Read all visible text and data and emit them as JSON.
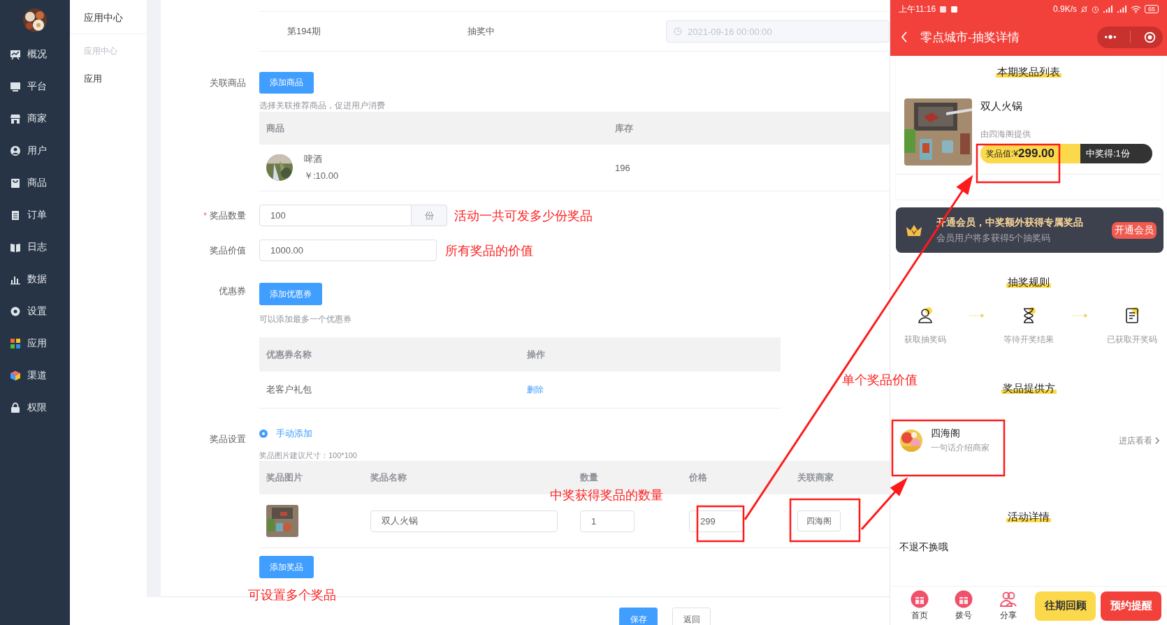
{
  "sidebar": {
    "items": [
      {
        "label": "概况"
      },
      {
        "label": "平台"
      },
      {
        "label": "商家"
      },
      {
        "label": "用户"
      },
      {
        "label": "商品"
      },
      {
        "label": "订单"
      },
      {
        "label": "日志"
      },
      {
        "label": "数据"
      },
      {
        "label": "设置"
      },
      {
        "label": "应用"
      },
      {
        "label": "渠道"
      },
      {
        "label": "权限"
      }
    ]
  },
  "submenu": {
    "title": "应用中心",
    "group": "应用中心",
    "items": [
      "应用"
    ]
  },
  "period_row": {
    "name": "第194期",
    "status": "抽奖中",
    "date": "2021-09-16 00:00:00"
  },
  "goods": {
    "label": "关联商品",
    "button": "添加商品",
    "hint": "选择关联推荐商品，促进用户消费",
    "columns": [
      "商品",
      "库存"
    ],
    "rows": [
      {
        "name": "啤酒",
        "price": "￥:10.00",
        "stock": "196"
      }
    ]
  },
  "prize_count": {
    "label": "奖品数量",
    "required_mark": "*",
    "value": "100",
    "suffix": "份",
    "note": "活动一共可发多少份奖品"
  },
  "prize_value": {
    "label": "奖品价值",
    "value": "1000.00",
    "note": "所有奖品的价值"
  },
  "coupon": {
    "label": "优惠券",
    "button": "添加优惠券",
    "hint": "可以添加最多一个优惠券",
    "columns": [
      "优惠券名称",
      "操作"
    ],
    "rows": [
      {
        "name": "老客户礼包",
        "action": "删除"
      }
    ]
  },
  "prize_settings": {
    "label": "奖品设置",
    "options": [
      {
        "label": "手动添加",
        "selected": true
      }
    ],
    "hint": "奖品图片建议尺寸：100*100",
    "columns": [
      "奖品图片",
      "奖品名称",
      "数量",
      "价格",
      "关联商家"
    ],
    "rows": [
      {
        "name": "双人火锅",
        "quantity": "1",
        "price": "299",
        "merchant": "四海阁"
      }
    ],
    "button": "添加奖品"
  },
  "footer": {
    "buttons": [
      {
        "label": "保存",
        "kind": "primary"
      },
      {
        "label": "返回",
        "kind": "default"
      }
    ]
  },
  "annotations": {
    "quantity_note": "中奖获得奖品的数量",
    "price_note": "单个奖品价值",
    "multi_note": "可设置多个奖品"
  },
  "phone": {
    "status_bar": {
      "time": "上午11:16",
      "speed": "0.9K/s",
      "battery": "65"
    },
    "title": "零点城市-抽奖详情",
    "prize_section": {
      "title": "本期奖品列表",
      "prizes": [
        {
          "name": "双人火锅",
          "provider": "由四海阁提供",
          "value_label": "奖品值:¥",
          "value": "299.00",
          "win": "中奖得:1份"
        }
      ]
    },
    "member": {
      "title": "开通会员，中奖额外获得专属奖品",
      "subtitle": "会员用户将多获得5个抽奖码",
      "button": "开通会员"
    },
    "rules": {
      "title": "抽奖规则",
      "steps": [
        "获取抽奖码",
        "等待开奖结果",
        "已获取开奖码"
      ]
    },
    "provider": {
      "title": "奖品提供方",
      "name": "四海阁",
      "intro": "一句话介绍商家",
      "link": "进店看看"
    },
    "details": {
      "title": "活动详情",
      "text": "不退不换哦"
    },
    "tabbar": {
      "items": [
        "首页",
        "拨号",
        "分享"
      ],
      "buttons": [
        "往期回顾",
        "预约提醒"
      ]
    }
  }
}
